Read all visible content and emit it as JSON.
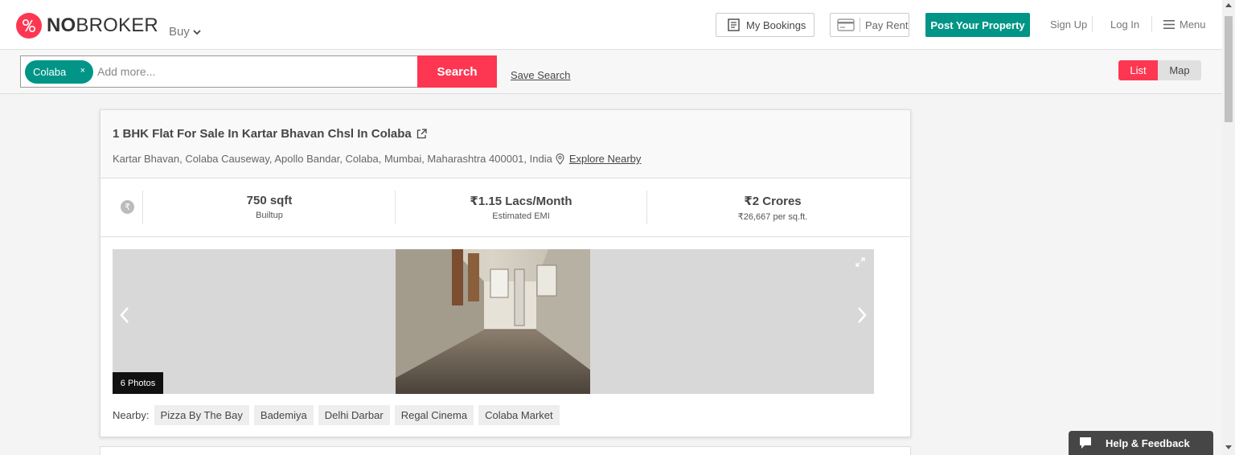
{
  "header": {
    "logo_bold": "NO",
    "logo_rest": "BROKER",
    "buy_label": "Buy",
    "my_bookings_label": "My Bookings",
    "pay_rent_label": "Pay Rent",
    "post_property_label": "Post Your Property",
    "sign_up_label": "Sign Up",
    "log_in_label": "Log In",
    "menu_label": "Menu"
  },
  "search": {
    "chip_label": "Colaba",
    "chip_remove": "×",
    "placeholder": "Add more...",
    "value": "",
    "button_label": "Search",
    "save_search_label": "Save Search",
    "view_list_label": "List",
    "view_map_label": "Map",
    "active_view": "List"
  },
  "listing": {
    "title": "1 BHK Flat For Sale In Kartar Bhavan Chsl In Colaba",
    "address": "Kartar Bhavan, Colaba Causeway, Apollo Bandar, Colaba, Mumbai, Maharashtra 400001, India",
    "explore_label": "Explore Nearby",
    "rupee_symbol": "₹",
    "stats": [
      {
        "value": "750 sqft",
        "label": "Builtup"
      },
      {
        "value": "₹1.15 Lacs/Month",
        "label": "Estimated EMI"
      },
      {
        "value": "₹2 Crores",
        "label": "₹26,667 per sq.ft."
      }
    ],
    "photo_count_label": "6 Photos",
    "nearby_label": "Nearby:",
    "nearby": [
      "Pizza By The Bay",
      "Bademiya",
      "Delhi Darbar",
      "Regal Cinema",
      "Colaba Market"
    ]
  },
  "help_label": "Help & Feedback",
  "colors": {
    "brand": "#fd3752",
    "teal": "#009587",
    "text": "#464646"
  },
  "icons": {
    "logo": "nobroker-logo-icon",
    "bookings": "bookings-icon",
    "pay_rent": "credit-card-icon",
    "menu": "hamburger-icon",
    "external": "external-link-icon",
    "location": "location-pin-icon",
    "help": "chat-bubble-icon"
  }
}
